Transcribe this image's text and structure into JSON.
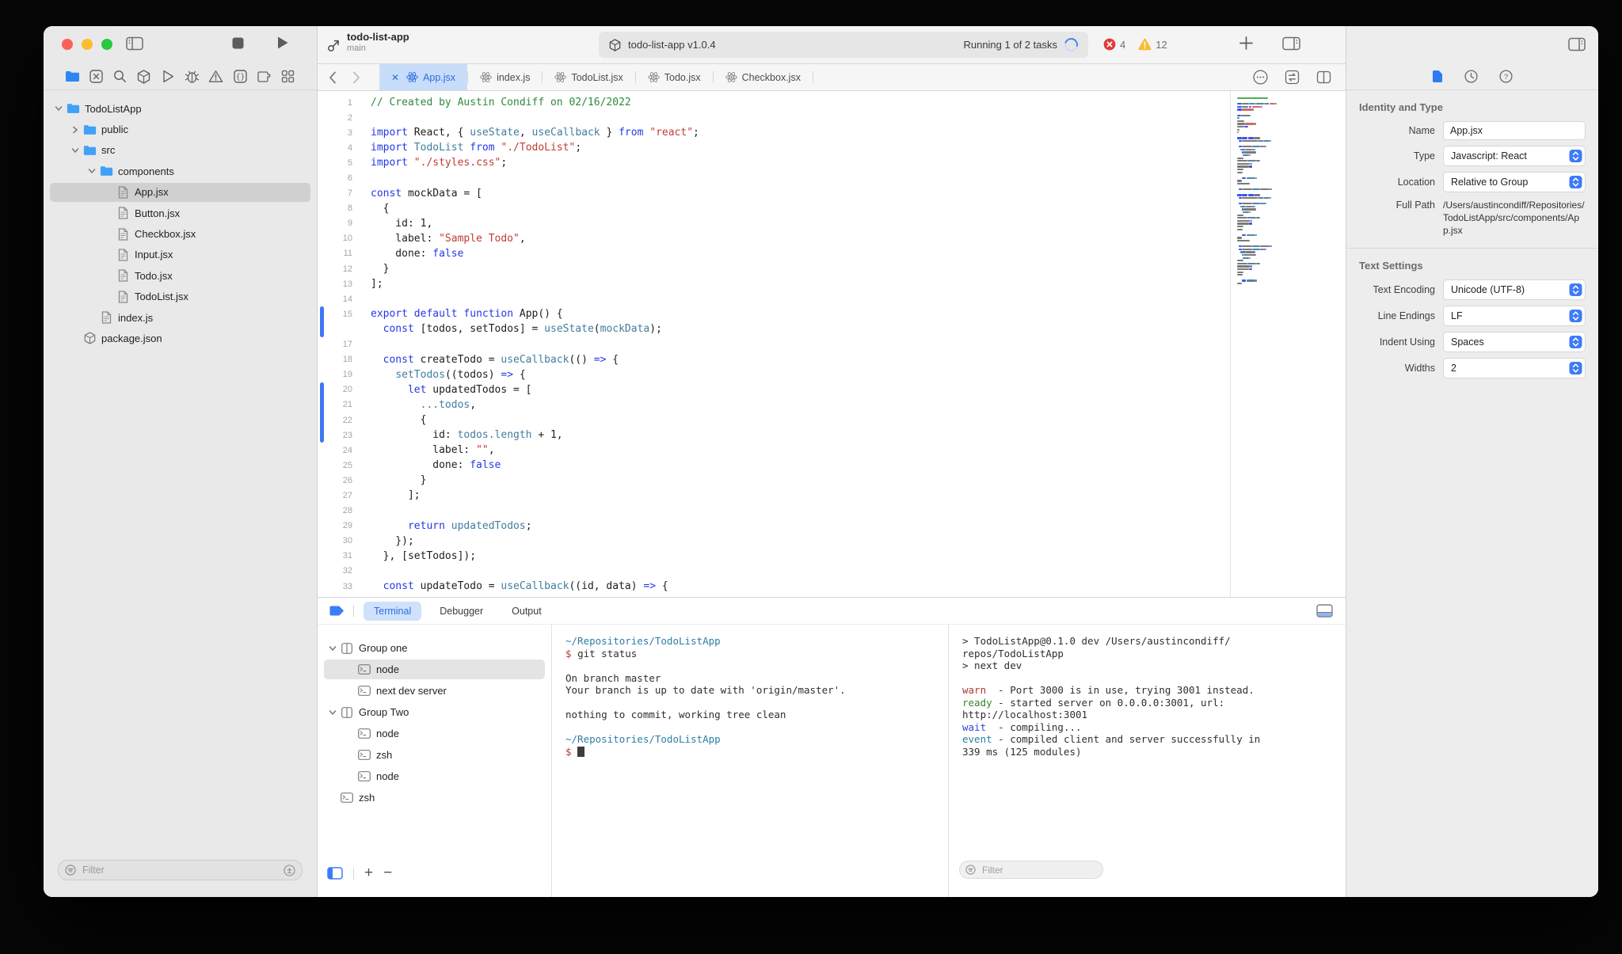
{
  "window": {
    "title": {
      "project": "todo-list-app",
      "branch": "main"
    },
    "status": {
      "package": "todo-list-app v1.0.4",
      "running": "Running 1 of 2 tasks",
      "errors": "4",
      "warnings": "12"
    }
  },
  "navigator": {
    "filter_placeholder": "Filter",
    "icons": [
      "folder",
      "xmark-square",
      "search",
      "package",
      "play",
      "bug",
      "warning",
      "braces",
      "extension",
      "grid"
    ],
    "tree": [
      {
        "d": 0,
        "c": "open",
        "i": "folder",
        "l": "TodoListApp"
      },
      {
        "d": 1,
        "c": "closed",
        "i": "folder",
        "l": "public"
      },
      {
        "d": 1,
        "c": "open",
        "i": "folder",
        "l": "src"
      },
      {
        "d": 2,
        "c": "open",
        "i": "folder",
        "l": "components"
      },
      {
        "d": 3,
        "i": "doc",
        "l": "App.jsx",
        "sel": true
      },
      {
        "d": 3,
        "i": "doc",
        "l": "Button.jsx"
      },
      {
        "d": 3,
        "i": "doc",
        "l": "Checkbox.jsx"
      },
      {
        "d": 3,
        "i": "doc",
        "l": "Input.jsx"
      },
      {
        "d": 3,
        "i": "doc",
        "l": "Todo.jsx"
      },
      {
        "d": 3,
        "i": "doc",
        "l": "TodoList.jsx"
      },
      {
        "d": 2,
        "i": "doc",
        "l": "index.js"
      },
      {
        "d": 1,
        "i": "cube",
        "l": "package.json"
      }
    ]
  },
  "tabs": [
    {
      "l": "App.jsx",
      "active": true
    },
    {
      "l": "index.js"
    },
    {
      "l": "TodoList.jsx"
    },
    {
      "l": "Todo.jsx"
    },
    {
      "l": "Checkbox.jsx"
    }
  ],
  "editor": {
    "change_bars": [
      [
        15,
        16
      ],
      [
        20,
        23
      ]
    ],
    "lines": [
      {
        "n": "1",
        "t": [
          [
            "// Created by Austin Condiff on 02/16/2022",
            "c"
          ]
        ]
      },
      {
        "n": "2",
        "t": []
      },
      {
        "n": "3",
        "t": [
          [
            "import",
            "k"
          ],
          [
            " React, { ",
            "p"
          ],
          [
            "useState",
            "f"
          ],
          [
            ", ",
            "p"
          ],
          [
            "useCallback",
            "f"
          ],
          [
            " } ",
            "p"
          ],
          [
            "from",
            "k"
          ],
          [
            " ",
            "p"
          ],
          [
            "\"react\"",
            "s"
          ],
          [
            ";",
            "p"
          ]
        ]
      },
      {
        "n": "4",
        "t": [
          [
            "import",
            "k"
          ],
          [
            " ",
            "p"
          ],
          [
            "TodoList",
            "f"
          ],
          [
            " ",
            "p"
          ],
          [
            "from",
            "k"
          ],
          [
            " ",
            "p"
          ],
          [
            "\"./TodoList\"",
            "s"
          ],
          [
            ";",
            "p"
          ]
        ]
      },
      {
        "n": "5",
        "t": [
          [
            "import",
            "k"
          ],
          [
            " ",
            "p"
          ],
          [
            "\"./styles.css\"",
            "s"
          ],
          [
            ";",
            "p"
          ]
        ]
      },
      {
        "n": "6",
        "t": []
      },
      {
        "n": "7",
        "t": [
          [
            "const",
            "k"
          ],
          [
            " mockData = [",
            "p"
          ]
        ]
      },
      {
        "n": "8",
        "t": [
          [
            "  {",
            "p"
          ]
        ]
      },
      {
        "n": "9",
        "t": [
          [
            "    id: 1,",
            "p"
          ]
        ]
      },
      {
        "n": "10",
        "t": [
          [
            "    label: ",
            "p"
          ],
          [
            "\"Sample Todo\"",
            "s"
          ],
          [
            ",",
            "p"
          ]
        ]
      },
      {
        "n": "11",
        "t": [
          [
            "    done: ",
            "p"
          ],
          [
            "false",
            "k"
          ]
        ]
      },
      {
        "n": "12",
        "t": [
          [
            "  }",
            "p"
          ]
        ]
      },
      {
        "n": "13",
        "t": [
          [
            "];",
            "p"
          ]
        ]
      },
      {
        "n": "14",
        "t": []
      },
      {
        "n": "15",
        "t": [
          [
            "export",
            "k"
          ],
          [
            " ",
            "p"
          ],
          [
            "default",
            "k"
          ],
          [
            " ",
            "p"
          ],
          [
            "function",
            "k"
          ],
          [
            " App() {",
            "p"
          ]
        ]
      },
      {
        "n": "",
        "t": [
          [
            "  ",
            "p"
          ],
          [
            "const",
            "k"
          ],
          [
            " [todos, setTodos] = ",
            "p"
          ],
          [
            "useState",
            "f"
          ],
          [
            "(",
            "p"
          ],
          [
            "mockData",
            "f"
          ],
          [
            ");",
            "p"
          ]
        ]
      },
      {
        "n": "17",
        "t": []
      },
      {
        "n": "18",
        "t": [
          [
            "  ",
            "p"
          ],
          [
            "const",
            "k"
          ],
          [
            " createTodo = ",
            "p"
          ],
          [
            "useCallback",
            "f"
          ],
          [
            "(() ",
            "p"
          ],
          [
            "=>",
            "k"
          ],
          [
            " {",
            "p"
          ]
        ]
      },
      {
        "n": "19",
        "t": [
          [
            "    ",
            "p"
          ],
          [
            "setTodos",
            "f"
          ],
          [
            "((todos) ",
            "p"
          ],
          [
            "=>",
            "k"
          ],
          [
            " {",
            "p"
          ]
        ]
      },
      {
        "n": "20",
        "t": [
          [
            "      ",
            "p"
          ],
          [
            "let",
            "k"
          ],
          [
            " updatedTodos = [",
            "p"
          ]
        ]
      },
      {
        "n": "21",
        "t": [
          [
            "        ",
            "p"
          ],
          [
            "...todos",
            "f"
          ],
          [
            ",",
            "p"
          ]
        ]
      },
      {
        "n": "22",
        "t": [
          [
            "        {",
            "p"
          ]
        ]
      },
      {
        "n": "23",
        "t": [
          [
            "          id: ",
            "p"
          ],
          [
            "todos.length",
            "f"
          ],
          [
            " + 1,",
            "p"
          ]
        ]
      },
      {
        "n": "24",
        "t": [
          [
            "          label: ",
            "p"
          ],
          [
            "\"\"",
            "s"
          ],
          [
            ",",
            "p"
          ]
        ]
      },
      {
        "n": "25",
        "t": [
          [
            "          done: ",
            "p"
          ],
          [
            "false",
            "k"
          ]
        ]
      },
      {
        "n": "26",
        "t": [
          [
            "        }",
            "p"
          ]
        ]
      },
      {
        "n": "27",
        "t": [
          [
            "      ];",
            "p"
          ]
        ]
      },
      {
        "n": "28",
        "t": []
      },
      {
        "n": "29",
        "t": [
          [
            "      ",
            "p"
          ],
          [
            "return",
            "k"
          ],
          [
            " ",
            "p"
          ],
          [
            "updatedTodos",
            "f"
          ],
          [
            ";",
            "p"
          ]
        ]
      },
      {
        "n": "30",
        "t": [
          [
            "    });",
            "p"
          ]
        ]
      },
      {
        "n": "31",
        "t": [
          [
            "  }, [setTodos]);",
            "p"
          ]
        ]
      },
      {
        "n": "32",
        "t": []
      },
      {
        "n": "33",
        "t": [
          [
            "  ",
            "p"
          ],
          [
            "const",
            "k"
          ],
          [
            " updateTodo = ",
            "p"
          ],
          [
            "useCallback",
            "f"
          ],
          [
            "((id, data) ",
            "p"
          ],
          [
            "=>",
            "k"
          ],
          [
            " {",
            "p"
          ]
        ]
      }
    ]
  },
  "inspector": {
    "sections": [
      {
        "title": "Identity and Type",
        "rows": [
          {
            "label": "Name",
            "type": "input",
            "value": "App.jsx"
          },
          {
            "label": "Type",
            "type": "select",
            "value": "Javascript: React"
          },
          {
            "label": "Location",
            "type": "select",
            "value": "Relative to Group"
          },
          {
            "label": "Full Path",
            "type": "text",
            "value": "/Users/austincondiff/Repositories/TodoListApp/src/components/App.jsx"
          }
        ]
      },
      {
        "title": "Text Settings",
        "rows": [
          {
            "label": "Text Encoding",
            "type": "select",
            "value": "Unicode (UTF-8)"
          },
          {
            "label": "Line Endings",
            "type": "select",
            "value": "LF"
          },
          {
            "label": "Indent Using",
            "type": "select",
            "value": "Spaces"
          },
          {
            "label": "Widths",
            "type": "select",
            "value": "2"
          }
        ]
      }
    ]
  },
  "bottom": {
    "filter_placeholder": "Filter",
    "tabs": [
      {
        "l": "Terminal",
        "active": true
      },
      {
        "l": "Debugger"
      },
      {
        "l": "Output"
      }
    ],
    "tree": [
      {
        "d": 0,
        "i": "group",
        "c": "open",
        "l": "Group one"
      },
      {
        "d": 1,
        "i": "term",
        "l": "node",
        "sel": true
      },
      {
        "d": 1,
        "i": "term",
        "l": "next dev server"
      },
      {
        "d": 0,
        "i": "group",
        "c": "open",
        "l": "Group Two"
      },
      {
        "d": 1,
        "i": "term",
        "l": "node"
      },
      {
        "d": 1,
        "i": "term",
        "l": "zsh"
      },
      {
        "d": 1,
        "i": "term",
        "l": "node"
      },
      {
        "d": 0,
        "i": "term",
        "l": "zsh"
      }
    ],
    "pane1": [
      [
        [
          "~/Repositories/TodoListApp",
          "path"
        ]
      ],
      [
        [
          "$ ",
          "dollar"
        ],
        [
          "git status",
          "cmd"
        ]
      ],
      [],
      [
        [
          "On branch master",
          "out"
        ]
      ],
      [
        [
          "Your branch is up to date with 'origin/master'.",
          "out"
        ]
      ],
      [],
      [
        [
          "nothing to commit, working tree clean",
          "out"
        ]
      ],
      [],
      [
        [
          "~/Repositories/TodoListApp",
          "path"
        ]
      ],
      [
        [
          "$ ",
          "dollar"
        ],
        [
          "",
          "cursor"
        ]
      ]
    ],
    "pane2": [
      [
        [
          "> TodoListApp@0.1.0 dev /Users/austincondiff/",
          "out"
        ]
      ],
      [
        [
          "repos/TodoListApp",
          "out"
        ]
      ],
      [
        [
          "> next dev",
          "out"
        ]
      ],
      [],
      [
        [
          "warn",
          "warn"
        ],
        [
          "  - Port 3000 is in use, trying 3001 instead.",
          "out"
        ]
      ],
      [
        [
          "ready",
          "ready"
        ],
        [
          " - started server on 0.0.0.0:3001, url:",
          "out"
        ]
      ],
      [
        [
          "http://localhost:3001",
          "out"
        ]
      ],
      [
        [
          "wait",
          "wait"
        ],
        [
          "  - compiling...",
          "out"
        ]
      ],
      [
        [
          "event",
          "event"
        ],
        [
          " - compiled client and server successfully in",
          "out"
        ]
      ],
      [
        [
          "339 ms (125 modules)",
          "out"
        ]
      ]
    ]
  }
}
